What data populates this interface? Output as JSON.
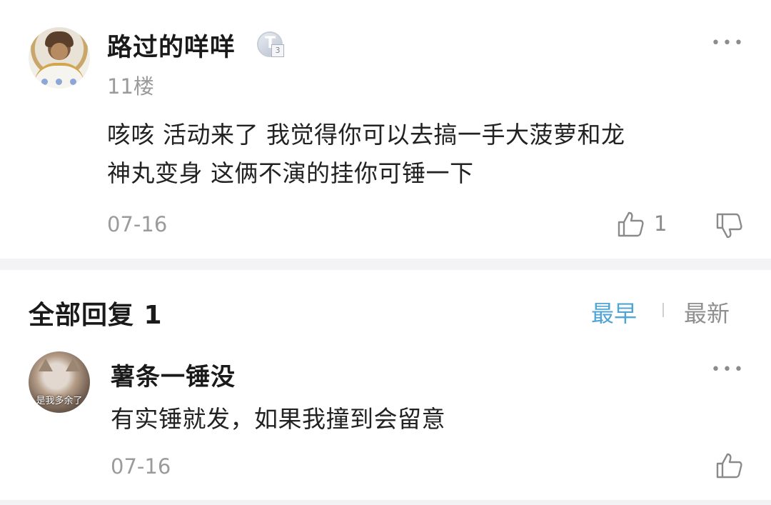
{
  "post": {
    "username": "路过的咩咩",
    "badge_letter": "T",
    "badge_level": "3",
    "floor": "11楼",
    "content_line1": "咳咳 活动来了 我觉得你可以去搞一手大菠萝和龙",
    "content_line2": "神丸变身 这俩不演的挂你可锤一下",
    "date": "07-16",
    "like_count": "1",
    "more_label": "•••"
  },
  "replies_header": {
    "title": "全部回复 1",
    "sort_earliest": "最早",
    "sort_newest": "最新",
    "active_sort": "earliest",
    "active_color": "#4fa5d6"
  },
  "reply": {
    "username": "薯条一锤没",
    "avatar_caption": "是我多余了",
    "content": "有实锤就发，如果我撞到会留意",
    "date": "07-16",
    "more_label": "•••"
  },
  "icons": [
    "thumbs-up-icon",
    "thumbs-down-icon",
    "more-icon",
    "badge-icon"
  ]
}
